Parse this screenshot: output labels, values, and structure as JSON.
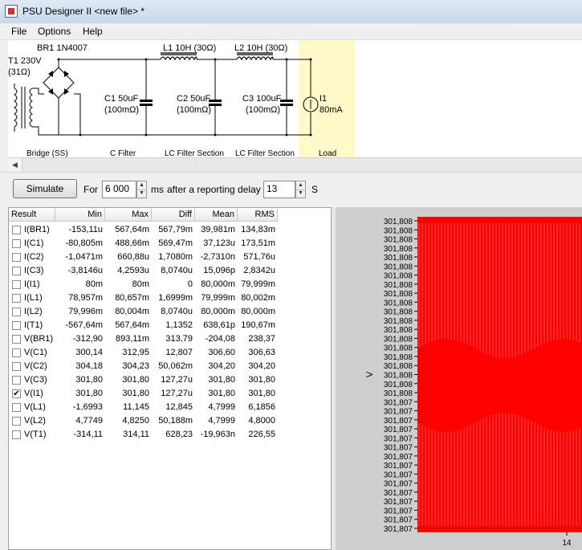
{
  "window": {
    "title": "PSU Designer II  <new file> *"
  },
  "menu": [
    "File",
    "Options",
    "Help"
  ],
  "schematic": {
    "components": {
      "t1": "T1 230V",
      "t1_res": "(31Ω)",
      "br1": "BR1 1N4007",
      "c1": "C1 50uF",
      "c1_res": "(100mΩ)",
      "l1": "L1 10H (30Ω)",
      "c2": "C2 50uF",
      "c2_res": "(100mΩ)",
      "l2": "L2 10H (30Ω)",
      "c3": "C3 100uF",
      "c3_res": "(100mΩ)",
      "i1": "I1",
      "i1_val": "80mA"
    },
    "sections": [
      "Bridge (SS)",
      "C Filter",
      "LC Filter Section",
      "LC Filter Section",
      "Load"
    ]
  },
  "toolbar": {
    "simulate": "Simulate",
    "for_label": "For",
    "duration": "6 000",
    "ms_label": "ms",
    "delay_label": "after a reporting delay of",
    "delay": "13",
    "s_label": "S"
  },
  "results": {
    "headers": [
      "Result",
      "Min",
      "Max",
      "Diff",
      "Mean",
      "RMS"
    ],
    "rows": [
      {
        "name": "I(BR1)",
        "checked": false,
        "min": "-153,11u",
        "max": "567,64m",
        "diff": "567,79m",
        "mean": "39,981m",
        "rms": "134,83m"
      },
      {
        "name": "I(C1)",
        "checked": false,
        "min": "-80,805m",
        "max": "488,66m",
        "diff": "569,47m",
        "mean": "37,123u",
        "rms": "173,51m"
      },
      {
        "name": "I(C2)",
        "checked": false,
        "min": "-1,0471m",
        "max": "660,88u",
        "diff": "1,7080m",
        "mean": "-2,7310n",
        "rms": "571,76u"
      },
      {
        "name": "I(C3)",
        "checked": false,
        "min": "-3,8146u",
        "max": "4,2593u",
        "diff": "8,0740u",
        "mean": "15,096p",
        "rms": "2,8342u"
      },
      {
        "name": "I(I1)",
        "checked": false,
        "min": "80m",
        "max": "80m",
        "diff": "0",
        "mean": "80,000m",
        "rms": "79,999m"
      },
      {
        "name": "I(L1)",
        "checked": false,
        "min": "78,957m",
        "max": "80,657m",
        "diff": "1,6999m",
        "mean": "79,999m",
        "rms": "80,002m"
      },
      {
        "name": "I(L2)",
        "checked": false,
        "min": "79,996m",
        "max": "80,004m",
        "diff": "8,0740u",
        "mean": "80,000m",
        "rms": "80,000m"
      },
      {
        "name": "I(T1)",
        "checked": false,
        "min": "-567,64m",
        "max": "567,64m",
        "diff": "1,1352",
        "mean": "638,61p",
        "rms": "190,67m"
      },
      {
        "name": "V(BR1)",
        "checked": false,
        "min": "-312,90",
        "max": "893,11m",
        "diff": "313,79",
        "mean": "-204,08",
        "rms": "238,37"
      },
      {
        "name": "V(C1)",
        "checked": false,
        "min": "300,14",
        "max": "312,95",
        "diff": "12,807",
        "mean": "306,60",
        "rms": "306,63"
      },
      {
        "name": "V(C2)",
        "checked": false,
        "min": "304,18",
        "max": "304,23",
        "diff": "50,062m",
        "mean": "304,20",
        "rms": "304,20"
      },
      {
        "name": "V(C3)",
        "checked": false,
        "min": "301,80",
        "max": "301,80",
        "diff": "127,27u",
        "mean": "301,80",
        "rms": "301,80"
      },
      {
        "name": "V(I1)",
        "checked": true,
        "min": "301,80",
        "max": "301,80",
        "diff": "127,27u",
        "mean": "301,80",
        "rms": "301,80"
      },
      {
        "name": "V(L1)",
        "checked": false,
        "min": "-1,6993",
        "max": "11,145",
        "diff": "12,845",
        "mean": "4,7999",
        "rms": "6,1856"
      },
      {
        "name": "V(L2)",
        "checked": false,
        "min": "4,7749",
        "max": "4,8250",
        "diff": "50,188m",
        "mean": "4,7999",
        "rms": "4,8000"
      },
      {
        "name": "V(T1)",
        "checked": false,
        "min": "-314,11",
        "max": "314,11",
        "diff": "628,23",
        "mean": "-19,963n",
        "rms": "226,55"
      }
    ]
  },
  "chart_data": {
    "type": "line",
    "ylabel": "V",
    "y_ticks": [
      "301,808",
      "301,808",
      "301,808",
      "301,808",
      "301,808",
      "301,808",
      "301,808",
      "301,808",
      "301,808",
      "301,808",
      "301,808",
      "301,808",
      "301,808",
      "301,808",
      "301,808",
      "301,808",
      "301,808",
      "301,808",
      "301,808",
      "301,808",
      "301,807",
      "301,807",
      "301,807",
      "301,807",
      "301,807",
      "301,807",
      "301,807",
      "301,807",
      "301,807",
      "301,807",
      "301,807",
      "301,807",
      "301,807",
      "301,807",
      "301,807"
    ],
    "x_ticks": [
      "14"
    ],
    "series": [
      {
        "color": "#ff0000"
      }
    ],
    "grid": true,
    "background": "#ff0000"
  }
}
